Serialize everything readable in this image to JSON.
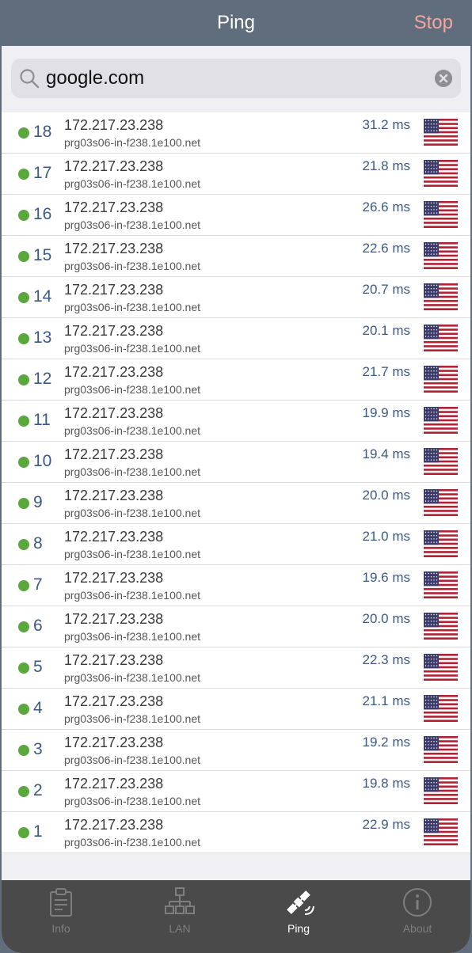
{
  "header": {
    "title": "Ping",
    "stop_label": "Stop"
  },
  "search": {
    "value": "google.com",
    "icon": "search-icon",
    "clear_icon": "clear-icon"
  },
  "pings": [
    {
      "seq": "18",
      "ip": "172.217.23.238",
      "host": "prg03s06-in-f238.1e100.net",
      "time": "31.2 ms",
      "flag": "us-flag-icon"
    },
    {
      "seq": "17",
      "ip": "172.217.23.238",
      "host": "prg03s06-in-f238.1e100.net",
      "time": "21.8 ms",
      "flag": "us-flag-icon"
    },
    {
      "seq": "16",
      "ip": "172.217.23.238",
      "host": "prg03s06-in-f238.1e100.net",
      "time": "26.6 ms",
      "flag": "us-flag-icon"
    },
    {
      "seq": "15",
      "ip": "172.217.23.238",
      "host": "prg03s06-in-f238.1e100.net",
      "time": "22.6 ms",
      "flag": "us-flag-icon"
    },
    {
      "seq": "14",
      "ip": "172.217.23.238",
      "host": "prg03s06-in-f238.1e100.net",
      "time": "20.7 ms",
      "flag": "us-flag-icon"
    },
    {
      "seq": "13",
      "ip": "172.217.23.238",
      "host": "prg03s06-in-f238.1e100.net",
      "time": "20.1 ms",
      "flag": "us-flag-icon"
    },
    {
      "seq": "12",
      "ip": "172.217.23.238",
      "host": "prg03s06-in-f238.1e100.net",
      "time": "21.7 ms",
      "flag": "us-flag-icon"
    },
    {
      "seq": "11",
      "ip": "172.217.23.238",
      "host": "prg03s06-in-f238.1e100.net",
      "time": "19.9 ms",
      "flag": "us-flag-icon"
    },
    {
      "seq": "10",
      "ip": "172.217.23.238",
      "host": "prg03s06-in-f238.1e100.net",
      "time": "19.4 ms",
      "flag": "us-flag-icon"
    },
    {
      "seq": "9",
      "ip": "172.217.23.238",
      "host": "prg03s06-in-f238.1e100.net",
      "time": "20.0 ms",
      "flag": "us-flag-icon"
    },
    {
      "seq": "8",
      "ip": "172.217.23.238",
      "host": "prg03s06-in-f238.1e100.net",
      "time": "21.0 ms",
      "flag": "us-flag-icon"
    },
    {
      "seq": "7",
      "ip": "172.217.23.238",
      "host": "prg03s06-in-f238.1e100.net",
      "time": "19.6 ms",
      "flag": "us-flag-icon"
    },
    {
      "seq": "6",
      "ip": "172.217.23.238",
      "host": "prg03s06-in-f238.1e100.net",
      "time": "20.0 ms",
      "flag": "us-flag-icon"
    },
    {
      "seq": "5",
      "ip": "172.217.23.238",
      "host": "prg03s06-in-f238.1e100.net",
      "time": "22.3 ms",
      "flag": "us-flag-icon"
    },
    {
      "seq": "4",
      "ip": "172.217.23.238",
      "host": "prg03s06-in-f238.1e100.net",
      "time": "21.1 ms",
      "flag": "us-flag-icon"
    },
    {
      "seq": "3",
      "ip": "172.217.23.238",
      "host": "prg03s06-in-f238.1e100.net",
      "time": "19.2 ms",
      "flag": "us-flag-icon"
    },
    {
      "seq": "2",
      "ip": "172.217.23.238",
      "host": "prg03s06-in-f238.1e100.net",
      "time": "19.8 ms",
      "flag": "us-flag-icon"
    },
    {
      "seq": "1",
      "ip": "172.217.23.238",
      "host": "prg03s06-in-f238.1e100.net",
      "time": "22.9 ms",
      "flag": "us-flag-icon"
    }
  ],
  "status_color": "#5aa83c",
  "tabs": [
    {
      "label": "Info",
      "icon": "clipboard-icon",
      "active": false
    },
    {
      "label": "LAN",
      "icon": "network-icon",
      "active": false
    },
    {
      "label": "Ping",
      "icon": "satellite-icon",
      "active": true
    },
    {
      "label": "About",
      "icon": "info-icon",
      "active": false
    }
  ],
  "colors": {
    "navbar": "#5f6d7d",
    "stop": "#f4a59f",
    "accent_text": "#3a5a85",
    "tabbar": "#4a4a4a"
  }
}
